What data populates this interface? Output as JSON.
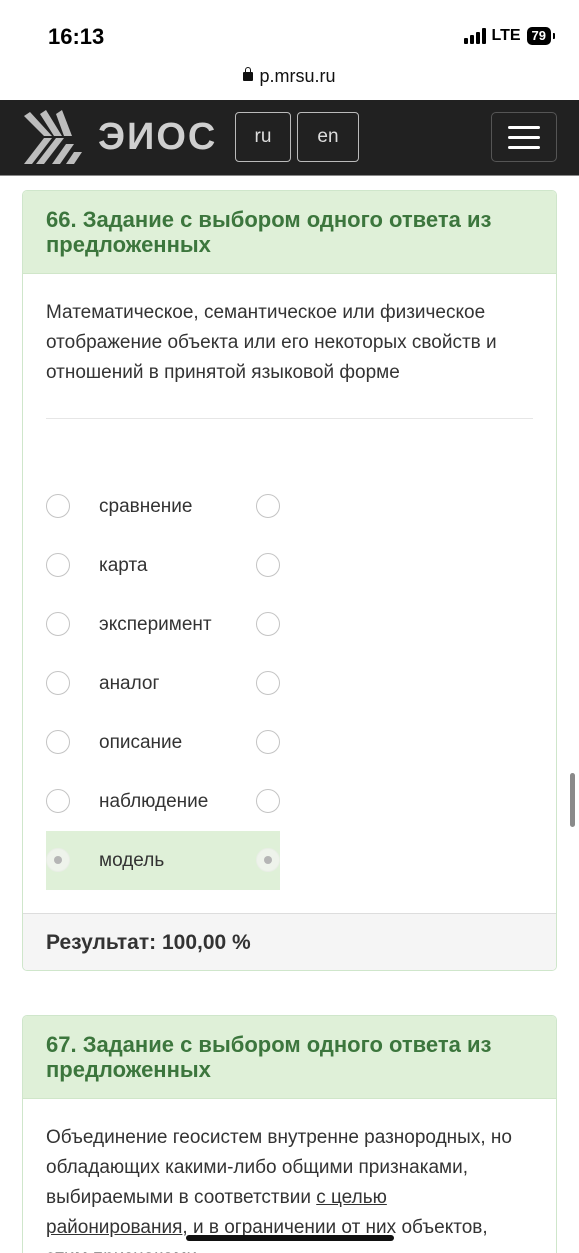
{
  "status_bar": {
    "time": "16:13",
    "network": "LTE",
    "battery": "79"
  },
  "browser": {
    "url": "p.mrsu.ru"
  },
  "header": {
    "logo_text": "ЭИОС",
    "lang_ru": "ru",
    "lang_en": "en"
  },
  "questions": [
    {
      "title": "66. Задание с выбором одного ответа из предложенных",
      "text": "Математическое, семантическое или физическое отображение объекта или его некоторых свойств и отношений в принятой языковой форме",
      "options": [
        {
          "label": "сравнение",
          "selected": false
        },
        {
          "label": "карта",
          "selected": false
        },
        {
          "label": "эксперимент",
          "selected": false
        },
        {
          "label": "аналог",
          "selected": false
        },
        {
          "label": "описание",
          "selected": false
        },
        {
          "label": "наблюдение",
          "selected": false
        },
        {
          "label": "модель",
          "selected": true
        }
      ],
      "result": "Результат: 100,00 %"
    },
    {
      "title": "67. Задание с выбором одного ответа из предложенных",
      "text_part1": "Объединение геосистем внутренне разнородных, но обладающих какими-либо общими признаками, выбираемыми в соответствии ",
      "text_part2": "с целью районирования",
      "text_part3": ", и в ограничении от них объектов, этим признаками"
    }
  ],
  "colors": {
    "header_bg": "#212121",
    "card_head_bg": "#dff0d8",
    "card_title": "#3c763d",
    "selected_bg": "#dff0d8"
  }
}
